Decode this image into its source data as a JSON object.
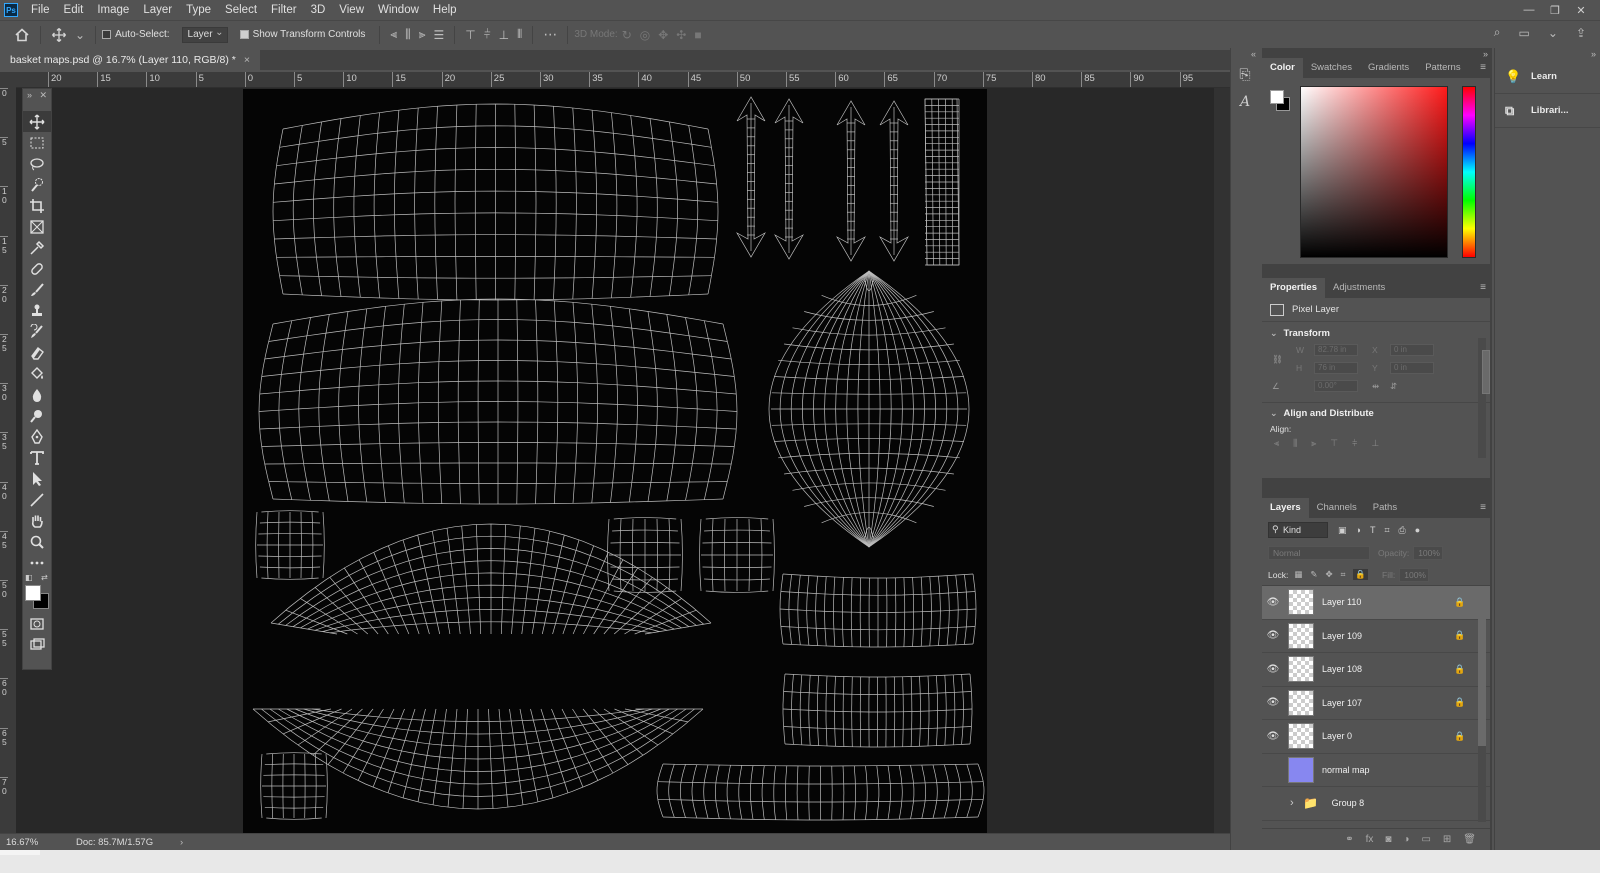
{
  "app": {
    "logo": "Ps"
  },
  "menu": [
    "File",
    "Edit",
    "Image",
    "Layer",
    "Type",
    "Select",
    "Filter",
    "3D",
    "View",
    "Window",
    "Help"
  ],
  "window_controls": [
    "—",
    "❐",
    "✕"
  ],
  "options": {
    "auto_select_label": "Auto-Select:",
    "auto_select_target": "Layer",
    "show_transform_label": "Show Transform Controls",
    "mode_3d_label": "3D Mode:"
  },
  "document_tab": {
    "title": "basket maps.psd @ 16.7% (Layer 110, RGB/8) *",
    "close": "×"
  },
  "rulers": {
    "h_ticks": [
      "20",
      "15",
      "10",
      "5",
      "0",
      "5",
      "10",
      "15",
      "20",
      "25",
      "30",
      "35",
      "40",
      "45",
      "50",
      "55",
      "60",
      "65",
      "70",
      "75",
      "80",
      "85",
      "90",
      "95"
    ],
    "v_ticks": [
      "0",
      "5",
      "1 0",
      "1 5",
      "2 0",
      "2 5",
      "3 0",
      "3 5",
      "4 0",
      "4 5",
      "5 0",
      "5 5",
      "6 0",
      "6 5",
      "7 0"
    ]
  },
  "status": {
    "zoom": "16.67%",
    "doc": "Doc: 85.7M/1.57G",
    "arrow": "›"
  },
  "color_panel": {
    "tabs": [
      "Color",
      "Swatches",
      "Gradients",
      "Patterns"
    ],
    "active": "Color",
    "fg": "#ffffff",
    "bg": "#000000"
  },
  "properties": {
    "tabs": [
      "Properties",
      "Adjustments"
    ],
    "kind": "Pixel Layer",
    "transform_title": "Transform",
    "w_label": "W",
    "w_value": "82.78 in",
    "x_label": "X",
    "x_value": "0 in",
    "h_label": "H",
    "h_value": "76 in",
    "y_label": "Y",
    "y_value": "0 in",
    "angle_value": "0.00°",
    "align_title": "Align and Distribute",
    "align_label": "Align:"
  },
  "layers_panel": {
    "tabs": [
      "Layers",
      "Channels",
      "Paths"
    ],
    "kind_label": "Kind",
    "blend_mode": "Normal",
    "opacity_label": "Opacity:",
    "opacity_value": "100%",
    "lock_label": "Lock:",
    "fill_label": "Fill:",
    "fill_value": "100%",
    "layers": [
      {
        "name": "Layer 110",
        "visible": true,
        "locked": true,
        "selected": true,
        "type": "pixel"
      },
      {
        "name": "Layer 109",
        "visible": true,
        "locked": true,
        "selected": false,
        "type": "pixel"
      },
      {
        "name": "Layer 108",
        "visible": true,
        "locked": true,
        "selected": false,
        "type": "pixel"
      },
      {
        "name": "Layer 107",
        "visible": true,
        "locked": true,
        "selected": false,
        "type": "pixel"
      },
      {
        "name": "Layer 0",
        "visible": true,
        "locked": true,
        "selected": false,
        "type": "pixel"
      },
      {
        "name": "normal map",
        "visible": false,
        "locked": false,
        "selected": false,
        "type": "normal"
      },
      {
        "name": "Group 8",
        "visible": false,
        "locked": false,
        "selected": false,
        "type": "group"
      }
    ]
  },
  "far_right": {
    "learn": "Learn",
    "libraries": "Librari..."
  }
}
